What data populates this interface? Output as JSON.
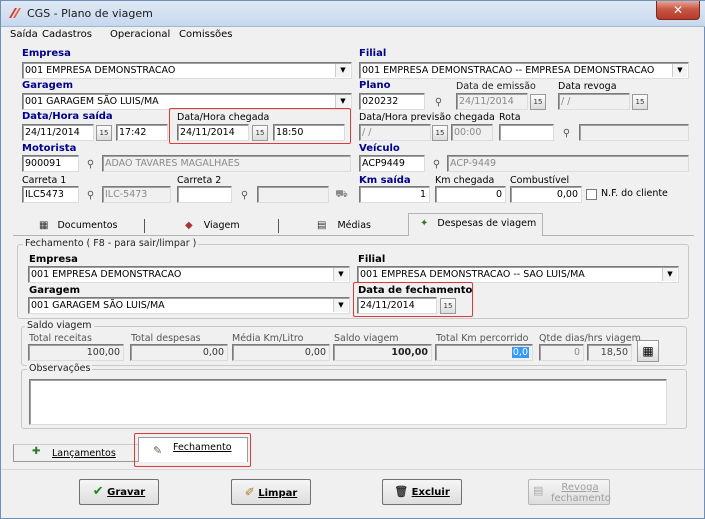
{
  "window": {
    "title": "CGS - Plano de viagem",
    "close_glyph": "✕"
  },
  "menu": [
    "Saída",
    "Cadastros",
    "Operacional",
    "Comissões"
  ],
  "header": {
    "empresa": {
      "label": "Empresa",
      "value": "001 EMPRESA DEMONSTRACAO"
    },
    "filial": {
      "label": "Filial",
      "value": "001 EMPRESA DEMONSTRACAO -- EMPRESA DEMONSTRACAO"
    },
    "garagem": {
      "label": "Garagem",
      "value": "001 GARAGEM SÃO LUIS/MA"
    },
    "plano": {
      "label": "Plano",
      "value": "020232"
    },
    "data_emissao": {
      "label": "Data de emissão",
      "value": "24/11/2014"
    },
    "data_revoga": {
      "label": "Data revoga",
      "value": " / /"
    },
    "data_hora_saida": {
      "label": "Data/Hora saída",
      "date": "24/11/2014",
      "time": "17:42"
    },
    "data_hora_chegada": {
      "label": "Data/Hora chegada",
      "date": "24/11/2014",
      "time": "18:50"
    },
    "previsao_chegada": {
      "label": "Data/Hora previsão chegada",
      "date": " / /",
      "time": "00:00"
    },
    "rota": {
      "label": "Rota",
      "value": ""
    },
    "motorista": {
      "label": "Motorista",
      "code": "900091",
      "name": "ADAO TAVARES MAGALHAES"
    },
    "veiculo": {
      "label": "Veículo",
      "plate": "ACP9449",
      "plate2": "ACP-9449"
    },
    "carreta1": {
      "label": "Carreta 1",
      "plate": "ILC5473",
      "plate2": "ILC-5473"
    },
    "carreta2": {
      "label": "Carreta 2",
      "plate": "",
      "plate2": ""
    },
    "km_saida": {
      "label": "Km saída",
      "value": "1"
    },
    "km_chegada": {
      "label": "Km chegada",
      "value": "0"
    },
    "combustivel": {
      "label": "Combustível",
      "value": "0,00"
    },
    "nf_cliente": {
      "label": "N.F. do cliente",
      "checked": false
    }
  },
  "tabs": [
    "Documentos",
    "Viagem",
    "Médias",
    "Despesas de viagem"
  ],
  "fechamento": {
    "group_label": "Fechamento ( F8 - para sair/limpar )",
    "empresa": {
      "label": "Empresa",
      "value": "001 EMPRESA DEMONSTRACAO"
    },
    "filial": {
      "label": "Filial",
      "value": "001 EMPRESA DEMONSTRACAO -- SAO LUIS/MA"
    },
    "garagem": {
      "label": "Garagem",
      "value": "001 GARAGEM SÃO LUIS/MA"
    },
    "data_fechamento": {
      "label": "Data de fechamento",
      "value": "24/11/2014"
    }
  },
  "saldo": {
    "group_label": "Saldo viagem",
    "total_receitas": {
      "label": "Total receitas",
      "value": "100,00"
    },
    "total_despesas": {
      "label": "Total despesas",
      "value": "0,00"
    },
    "media_km_litro": {
      "label": "Média Km/Litro",
      "value": "0,00"
    },
    "saldo_viagem": {
      "label": "Saldo viagem",
      "value": "100,00"
    },
    "total_km": {
      "label": "Total Km percorrido",
      "value": "0,0"
    },
    "qtde_dias": {
      "label": "Qtde dias/hrs viagem",
      "days": "0",
      "hours": "18,50"
    }
  },
  "observacoes": {
    "label": "Observações",
    "value": ""
  },
  "subtabs": [
    "Lançamentos",
    "Fechamento"
  ],
  "buttons": {
    "gravar": "Gravar",
    "limpar": "Limpar",
    "excluir": "Excluir",
    "revoga_1": "Revoga",
    "revoga_2": "fechamento"
  },
  "colors": {
    "label_blue": "#00008b",
    "highlight_red": "#e0383a",
    "selection": "#3399ff"
  }
}
